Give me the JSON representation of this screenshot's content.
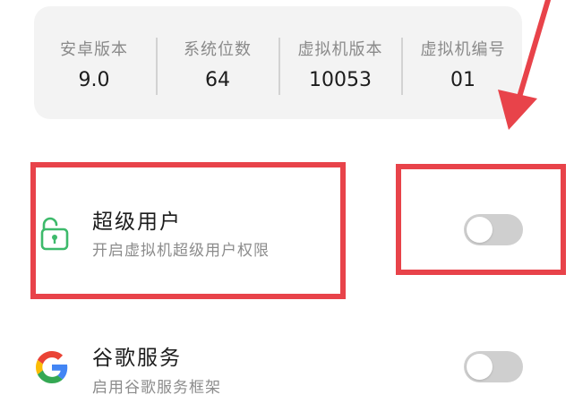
{
  "info": [
    {
      "label": "安卓版本",
      "value": "9.0"
    },
    {
      "label": "系统位数",
      "value": "64"
    },
    {
      "label": "虚拟机版本",
      "value": "10053"
    },
    {
      "label": "虚拟机编号",
      "value": "01"
    }
  ],
  "settings": {
    "superuser": {
      "title": "超级用户",
      "subtitle": "开启虚拟机超级用户权限",
      "enabled": false,
      "icon": "unlock-icon"
    },
    "google": {
      "title": "谷歌服务",
      "subtitle": "启用谷歌服务框架",
      "enabled": false,
      "icon": "google-icon"
    }
  },
  "colors": {
    "annotation_red": "#e8434a",
    "toggle_off": "#cfcfcf",
    "unlock_green": "#3dba6b"
  }
}
